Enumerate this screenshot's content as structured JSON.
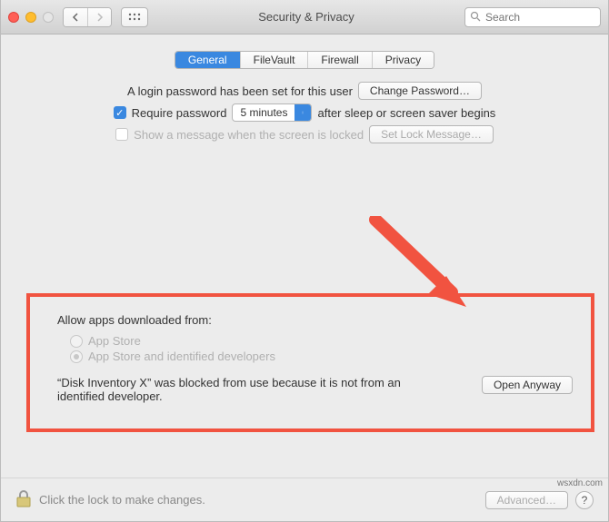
{
  "titlebar": {
    "title": "Security & Privacy",
    "search_placeholder": "Search"
  },
  "tabs": {
    "general": "General",
    "filevault": "FileVault",
    "firewall": "Firewall",
    "privacy": "Privacy"
  },
  "login": {
    "password_set": "A login password has been set for this user",
    "change_password": "Change Password…",
    "require_password": "Require password",
    "delay_value": "5 minutes",
    "after_sleep": "after sleep or screen saver begins",
    "show_message": "Show a message when the screen is locked",
    "set_lock_message": "Set Lock Message…"
  },
  "allow": {
    "title": "Allow apps downloaded from:",
    "appstore": "App Store",
    "appstore_identified": "App Store and identified developers",
    "blocked_msg": "“Disk Inventory X” was blocked from use because it is not from an identified developer.",
    "open_anyway": "Open Anyway"
  },
  "footer": {
    "lock_text": "Click the lock to make changes.",
    "advanced": "Advanced…"
  },
  "watermark": "wsxdn.com"
}
